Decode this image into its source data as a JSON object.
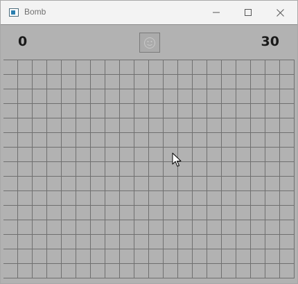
{
  "window": {
    "title": "Bomb",
    "icon": "window-app-icon",
    "controls": [
      "minimize-icon",
      "maximize-icon",
      "close-icon"
    ]
  },
  "hud": {
    "mines_left": "0",
    "timer": "30",
    "face_icon": "smiley-face-icon"
  },
  "board": {
    "columns": 20,
    "rows": 15,
    "cell_state": "unrevealed",
    "cell_color": "#b2b2b2",
    "grid_line_color": "#6f6f6f"
  },
  "cursor": "arrow-cursor-icon"
}
